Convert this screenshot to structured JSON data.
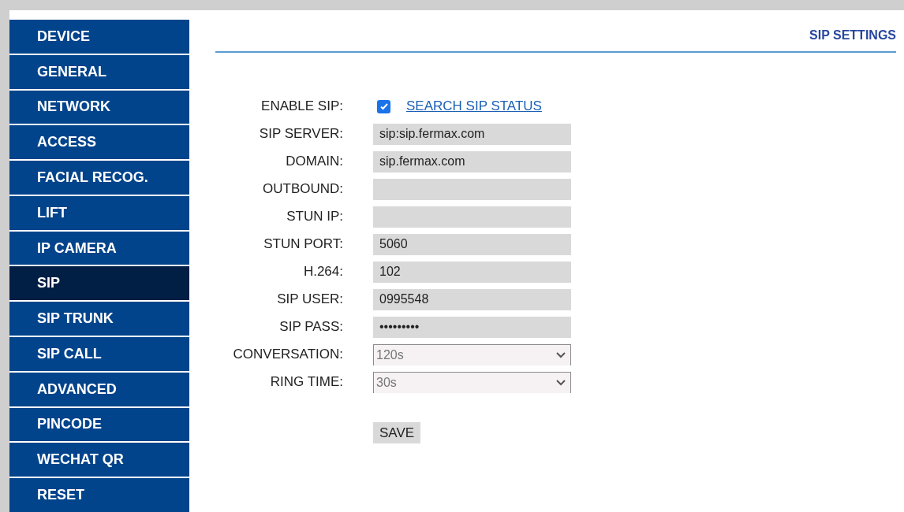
{
  "sidebar": {
    "items": [
      {
        "label": "DEVICE",
        "selected": false
      },
      {
        "label": "GENERAL",
        "selected": false
      },
      {
        "label": "NETWORK",
        "selected": false
      },
      {
        "label": "ACCESS",
        "selected": false
      },
      {
        "label": "FACIAL RECOG.",
        "selected": false
      },
      {
        "label": "LIFT",
        "selected": false
      },
      {
        "label": "IP CAMERA",
        "selected": false
      },
      {
        "label": "SIP",
        "selected": true
      },
      {
        "label": "SIP TRUNK",
        "selected": false
      },
      {
        "label": "SIP CALL",
        "selected": false
      },
      {
        "label": "ADVANCED",
        "selected": false
      },
      {
        "label": "PINCODE",
        "selected": false
      },
      {
        "label": "WECHAT QR",
        "selected": false
      },
      {
        "label": "RESET",
        "selected": false
      }
    ]
  },
  "title": "SIP SETTINGS",
  "form": {
    "rows": [
      {
        "kind": "checkbox",
        "label": "ENABLE SIP:",
        "checked": true,
        "link": "SEARCH SIP STATUS"
      },
      {
        "kind": "text",
        "label": "SIP SERVER:",
        "value": "sip:sip.fermax.com"
      },
      {
        "kind": "text",
        "label": "DOMAIN:",
        "value": "sip.fermax.com"
      },
      {
        "kind": "text",
        "label": "OUTBOUND:"
      },
      {
        "kind": "text",
        "label": "STUN IP:"
      },
      {
        "kind": "text",
        "label": "STUN PORT:",
        "value": "5060"
      },
      {
        "kind": "text",
        "label": "H.264:",
        "value": "102"
      },
      {
        "kind": "text",
        "label": "SIP USER:",
        "value": "0995548"
      },
      {
        "kind": "text",
        "label": "SIP PASS:",
        "value": "•••••••••"
      },
      {
        "kind": "select",
        "label": "CONVERSATION:",
        "value": "120s"
      },
      {
        "kind": "select",
        "label": "RING TIME:",
        "value": "30s"
      }
    ],
    "save_button": "SAVE"
  }
}
